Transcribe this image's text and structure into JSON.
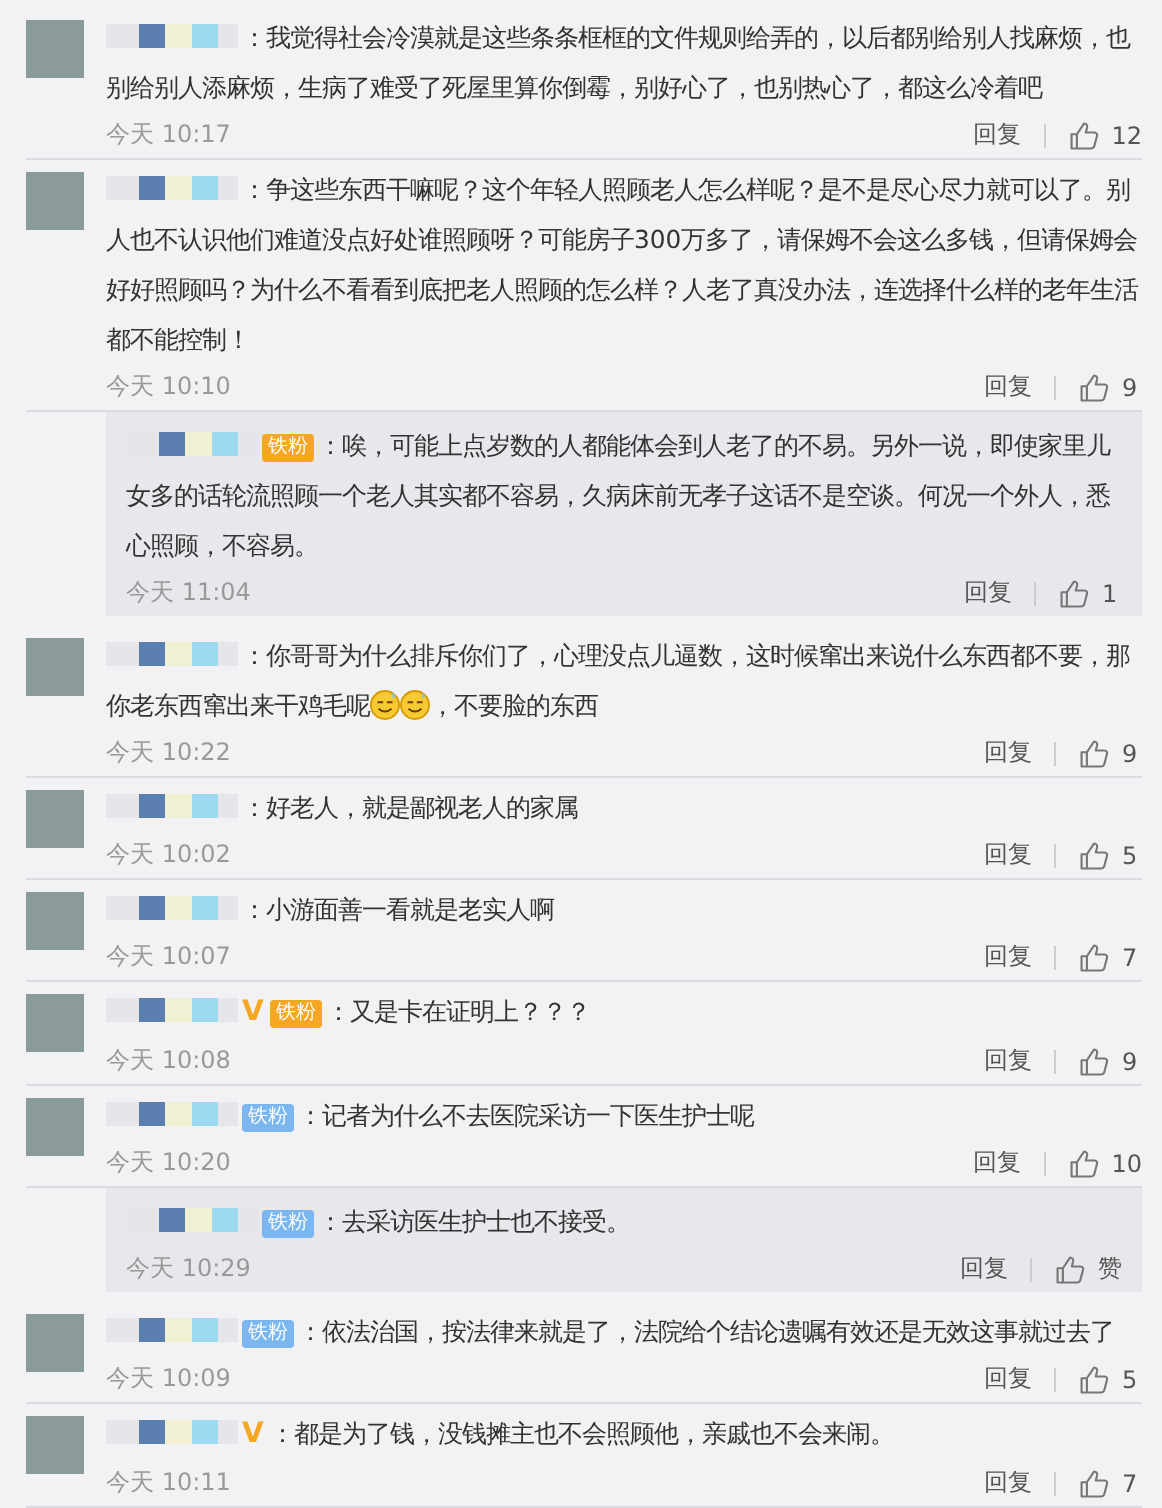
{
  "comments": [
    {
      "kind": "comment",
      "text": "：我觉得社会冷漠就是这些条条框框的文件规则给弄的，以后都别给别人找麻烦，也别给别人添麻烦，生病了难受了死屋里算你倒霉，别好心了，也别热心了，都这么冷着吧",
      "time": "今天 10:17",
      "reply": "回复",
      "likes": "12"
    },
    {
      "kind": "comment",
      "text": "：争这些东西干嘛呢？这个年轻人照顾老人怎么样呢？是不是尽心尽力就可以了。别人也不认识他们难道没点好处谁照顾呀？可能房子300万多了，请保姆不会这么多钱，但请保姆会好好照顾吗？为什么不看看到底把老人照顾的怎么样？人老了真没办法，连选择什么样的老年生活都不能控制！",
      "time": "今天 10:10",
      "reply": "回复",
      "likes": "9"
    },
    {
      "kind": "reply",
      "badges": [
        {
          "kind": "crown-fan",
          "text": "铁粉"
        }
      ],
      "text": "：唉，可能上点岁数的人都能体会到人老了的不易。另外一说，即使家里儿女多的话轮流照顾一个老人其实都不容易，久病床前无孝子这话不是空谈。何况一个外人，悉心照顾，不容易。",
      "time": "今天 11:04",
      "reply": "回复",
      "likes": "1"
    },
    {
      "kind": "comment",
      "text": "：你哥哥为什么排斥你们了，心理没点儿逼数，这时候窜出来说什么东西都不要，那你老东西窜出来干鸡毛呢",
      "emojis": [
        {
          "kind": "sweat-smile"
        },
        {
          "kind": "sweat-smile"
        }
      ],
      "tail": "，不要脸的东西",
      "time": "今天 10:22",
      "reply": "回复",
      "likes": "9"
    },
    {
      "kind": "comment",
      "text": "：好老人，就是鄙视老人的家属",
      "time": "今天 10:02",
      "reply": "回复",
      "likes": "5"
    },
    {
      "kind": "comment",
      "text": "：小游面善一看就是老实人啊",
      "time": "今天 10:07",
      "reply": "回复",
      "likes": "7"
    },
    {
      "kind": "comment",
      "badges": [
        {
          "kind": "v",
          "text": "V"
        },
        {
          "kind": "crown-fan",
          "text": "铁粉"
        }
      ],
      "text": "：又是卡在证明上？？？",
      "time": "今天 10:08",
      "reply": "回复",
      "likes": "9"
    },
    {
      "kind": "comment",
      "badges": [
        {
          "kind": "fan",
          "text": "铁粉"
        }
      ],
      "text": "：记者为什么不去医院采访一下医生护士呢",
      "time": "今天 10:20",
      "reply": "回复",
      "likes": "10"
    },
    {
      "kind": "reply",
      "badges": [
        {
          "kind": "fan",
          "text": "铁粉"
        }
      ],
      "text": "：去采访医生护士也不接受。",
      "time": "今天 10:29",
      "reply": "回复",
      "likes": "赞"
    },
    {
      "kind": "comment",
      "badges": [
        {
          "kind": "fan",
          "text": "铁粉"
        }
      ],
      "text": "：依法治国，按法律来就是了，法院给个结论遗嘱有效还是无效这事就过去了",
      "time": "今天 10:09",
      "reply": "回复",
      "likes": "5"
    },
    {
      "kind": "comment",
      "badges": [
        {
          "kind": "v",
          "text": "V"
        }
      ],
      "text": "：都是为了钱，没钱摊主也不会照顾他，亲戚也不会来闹。",
      "time": "今天 10:11",
      "reply": "回复",
      "likes": "7"
    }
  ]
}
